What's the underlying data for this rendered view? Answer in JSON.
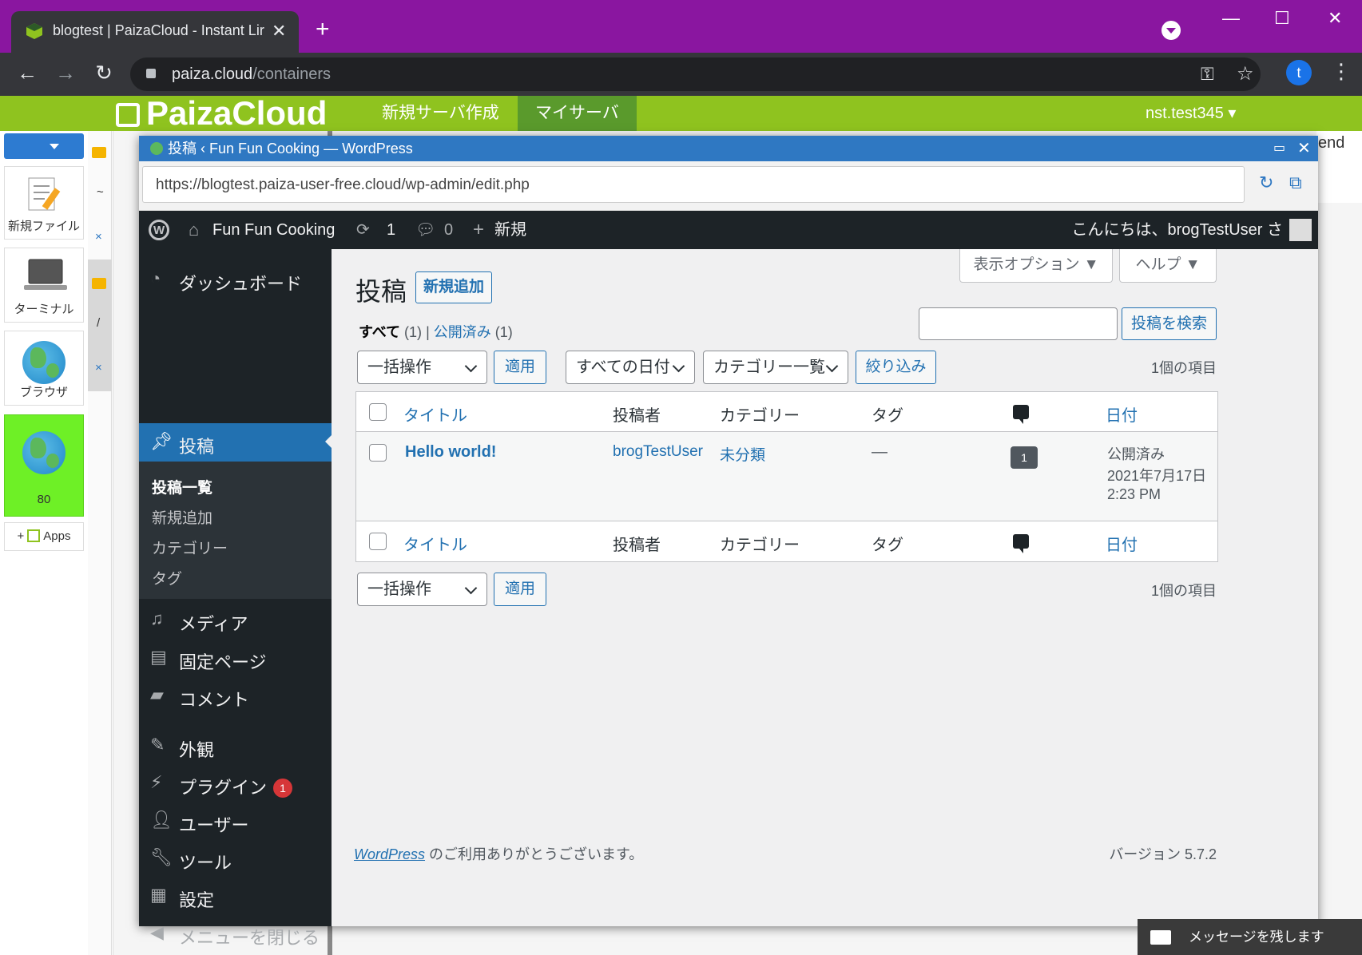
{
  "chrome": {
    "tab_title": "blogtest | PaizaCloud - Instant Lir",
    "tab_close": "✕",
    "new_tab": "+",
    "url_host": "paiza.cloud",
    "url_path": "/containers",
    "profile_initial": "t",
    "window_controls": {
      "minimize": "—",
      "maximize": "☐",
      "close": "✕"
    }
  },
  "paiza": {
    "logo": "PaizaCloud",
    "nav": [
      "新規サーバ作成",
      "マイサーバ"
    ],
    "user": "nst.test345 ▾",
    "apps": [
      {
        "label": "新規ファイル"
      },
      {
        "label": "ターミナル"
      },
      {
        "label": "ブラウザ"
      },
      {
        "label": "80"
      }
    ],
    "add_apps": "Apps",
    "side_marks": [
      "~",
      "×",
      "/",
      "×"
    ],
    "bg_text": "end"
  },
  "browser": {
    "title": "投稿 ‹ Fun Fun Cooking — WordPress",
    "url": "https://blogtest.paiza-user-free.cloud/wp-admin/edit.php",
    "maximize": "▭",
    "close": "✕"
  },
  "wp": {
    "adminbar": {
      "site_name": "Fun Fun Cooking",
      "updates_count": "1",
      "comments_count": "0",
      "new_label": "新規",
      "greeting": "こんにちは、brogTestUser さん"
    },
    "menu": {
      "dashboard": "ダッシュボード",
      "posts": "投稿",
      "submenu": [
        "投稿一覧",
        "新規追加",
        "カテゴリー",
        "タグ"
      ],
      "media": "メディア",
      "pages": "固定ページ",
      "comments": "コメント",
      "appearance": "外観",
      "plugins": "プラグイン",
      "plugins_badge": "1",
      "users": "ユーザー",
      "tools": "ツール",
      "settings": "設定",
      "collapse": "メニューを閉じる"
    },
    "screen_options": "表示オプション ▼",
    "help": "ヘルプ ▼",
    "page_title": "投稿",
    "add_new": "新規追加",
    "filters": {
      "all": "すべて",
      "all_count": "(1)",
      "sep": "|",
      "published": "公開済み",
      "published_count": "(1)"
    },
    "search_placeholder": "",
    "search_button": "投稿を検索",
    "bulk_action": "一括操作",
    "apply": "適用",
    "date_filter": "すべての日付",
    "category_filter": "カテゴリー一覧",
    "filter_button": "絞り込み",
    "item_count": "1個の項目",
    "columns": {
      "title": "タイトル",
      "author": "投稿者",
      "categories": "カテゴリー",
      "tags": "タグ",
      "date": "日付"
    },
    "rows": [
      {
        "title": "Hello world!",
        "author": "brogTestUser",
        "category": "未分類",
        "tags": "—",
        "comments": "1",
        "status": "公開済み",
        "date": "2021年7月17日",
        "time": "2:23 PM"
      }
    ],
    "footer_link": "WordPress",
    "footer_text": " のご利用ありがとうございます。",
    "version": "バージョン 5.7.2"
  },
  "chat": {
    "label": "メッセージを残します"
  }
}
